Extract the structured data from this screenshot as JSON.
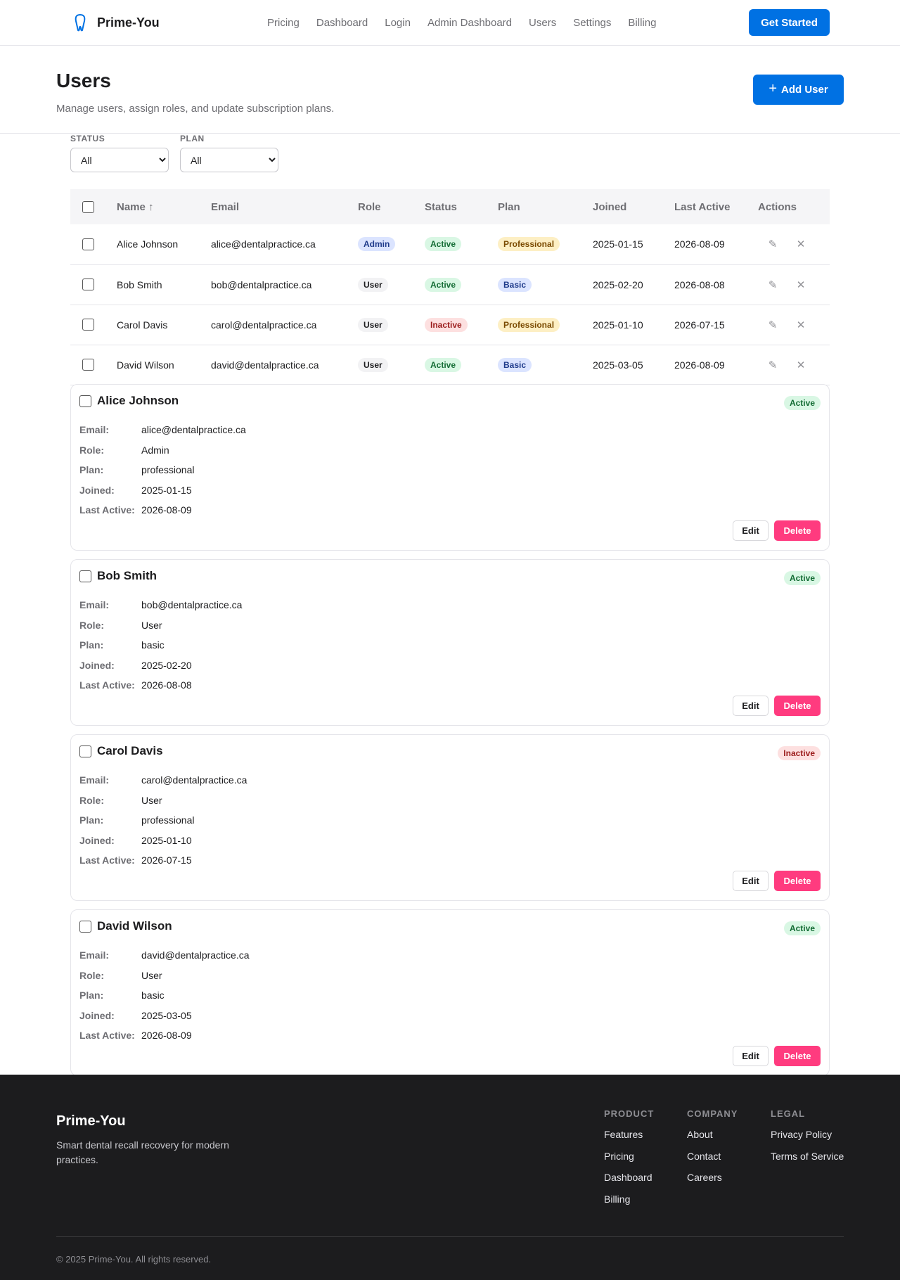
{
  "nav": {
    "brand": "Prime-You",
    "links": [
      "Pricing",
      "Dashboard",
      "Login",
      "Admin Dashboard",
      "Users",
      "Settings",
      "Billing"
    ],
    "cta": "Get Started"
  },
  "header": {
    "title": "Users",
    "subtitle": "Manage users, assign roles, and update subscription plans.",
    "add_button": "Add User"
  },
  "filters": {
    "status": {
      "label": "STATUS",
      "value": "All"
    },
    "plan": {
      "label": "PLAN",
      "value": "All"
    }
  },
  "table": {
    "headers": [
      "Name ↑",
      "Email",
      "Role",
      "Status",
      "Plan",
      "Joined",
      "Last Active",
      "Actions"
    ],
    "rows": [
      {
        "name": "Alice Johnson",
        "email": "alice@dentalpractice.ca",
        "role": "Admin",
        "status": "Active",
        "plan": "Professional",
        "joined": "2025-01-15",
        "last_active": "2026-08-09"
      },
      {
        "name": "Bob Smith",
        "email": "bob@dentalpractice.ca",
        "role": "User",
        "status": "Active",
        "plan": "Basic",
        "joined": "2025-02-20",
        "last_active": "2026-08-08"
      },
      {
        "name": "Carol Davis",
        "email": "carol@dentalpractice.ca",
        "role": "User",
        "status": "Inactive",
        "plan": "Professional",
        "joined": "2025-01-10",
        "last_active": "2026-07-15"
      },
      {
        "name": "David Wilson",
        "email": "david@dentalpractice.ca",
        "role": "User",
        "status": "Active",
        "plan": "Basic",
        "joined": "2025-03-05",
        "last_active": "2026-08-09"
      }
    ],
    "action_icons": [
      "pencil-icon",
      "close-icon"
    ]
  },
  "cards": {
    "labels": {
      "email": "Email:",
      "role": "Role:",
      "plan": "Plan:",
      "joined": "Joined:",
      "last_active": "Last Active:"
    },
    "edit_label": "Edit",
    "delete_label": "Delete",
    "items": [
      {
        "name": "Alice Johnson",
        "status": "Active",
        "email": "alice@dentalpractice.ca",
        "role": "Admin",
        "plan": "professional",
        "joined": "2025-01-15",
        "last_active": "2026-08-09"
      },
      {
        "name": "Bob Smith",
        "status": "Active",
        "email": "bob@dentalpractice.ca",
        "role": "User",
        "plan": "basic",
        "joined": "2025-02-20",
        "last_active": "2026-08-08"
      },
      {
        "name": "Carol Davis",
        "status": "Inactive",
        "email": "carol@dentalpractice.ca",
        "role": "User",
        "plan": "professional",
        "joined": "2025-01-10",
        "last_active": "2026-07-15"
      },
      {
        "name": "David Wilson",
        "status": "Active",
        "email": "david@dentalpractice.ca",
        "role": "User",
        "plan": "basic",
        "joined": "2025-03-05",
        "last_active": "2026-08-09"
      }
    ]
  },
  "footer": {
    "brand": "Prime-You",
    "tagline": "Smart dental recall recovery for modern practices.",
    "columns": [
      {
        "title": "PRODUCT",
        "links": [
          "Features",
          "Pricing",
          "Dashboard",
          "Billing"
        ]
      },
      {
        "title": "COMPANY",
        "links": [
          "About",
          "Contact",
          "Careers"
        ]
      },
      {
        "title": "LEGAL",
        "links": [
          "Privacy Policy",
          "Terms of Service"
        ]
      }
    ],
    "copyright": "© 2025 Prime-You. All rights reserved."
  },
  "colors": {
    "accent": "#0071e3",
    "delete": "#ff3b7f",
    "footer_bg": "#1c1c1e"
  }
}
